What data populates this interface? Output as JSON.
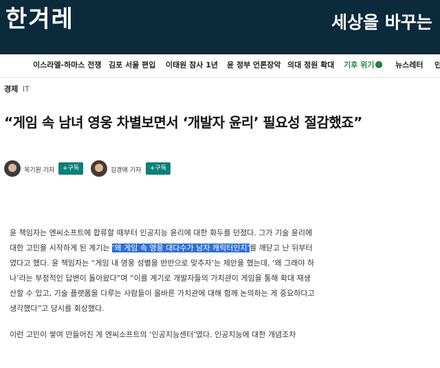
{
  "header": {
    "logo": "한겨레",
    "slogan": "세상을 바꾸는"
  },
  "nav": {
    "items": [
      "이스라엘-하마스 전쟁",
      "김포 서울 편입",
      "이태원 참사 1년",
      "윤 정부 언론장악",
      "의대 정원 확대",
      "기후 위기",
      "뉴스레터",
      "인"
    ]
  },
  "article": {
    "section": "경제",
    "subsection": "IT",
    "headline": "“게임 속 남녀 영웅 차별보면서 ‘개발자 윤리’ 필요성 절감했죠”",
    "reporters": [
      {
        "name": "옥기원 기자",
        "subscribe": "+구독"
      },
      {
        "name": "김경애 기자",
        "subscribe": "+구독"
      }
    ],
    "p1_a": "윤 책임자는 엔씨소프트에 합류할 때부터 인공지능 윤리에 대한 화두를 던졌다. 그가 기술 윤리에 대한 고민을 시작하게 된 계기는 ",
    "p1_highlight": "‘왜 게임 속 영웅 대다수가 남자 캐릭터인지’",
    "p1_b": "를 깨닫고 난 뒤부터였다고 했다. 윤 책임자는 “게임 내 영웅 성별을 반반으로 맞추자’는 제안을 했는데, ‘왜 그래야 하나’라는 부정적인 답변이 돌아왔다”며 “이를 계기로 개발자들의 가치관이 게임을 통해 확대 재생산할 수 있고, 기술 플랫폼을 다루는 사람들이 올바른 가치관에 대해 함께 논의하는 게 중요하다고 생각했다”고 당시를 회상했다.",
    "p2": "이런 고민이 쌓여 만들어진 게 엔씨소프트의 ‘인공지능센터’였다. 인공지능에 대한 개념조차"
  },
  "colors": {
    "masthead": "#0b2a3b",
    "subscribe": "#0e7f79",
    "climate": "#1e8a3c",
    "highlight": "#2f6fd6"
  }
}
